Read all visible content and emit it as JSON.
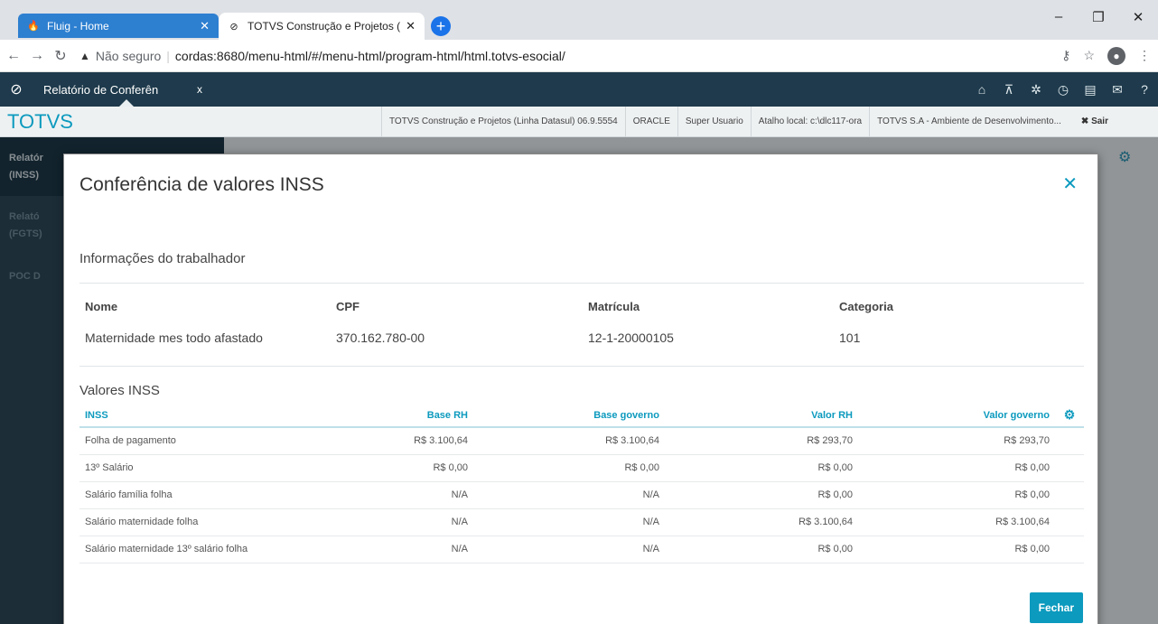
{
  "browser": {
    "tabs": [
      {
        "label": "Fluig - Home",
        "icon": "fluig-icon"
      },
      {
        "label": "TOTVS Construção e Projetos (Lin",
        "icon": "totvs-icon"
      }
    ],
    "url_security": "Não seguro",
    "url": "cordas:8680/menu-html/#/menu-html/program-html/html.totvs-esocial/"
  },
  "app": {
    "tab_label": "Relatório de Conferên",
    "brand": "TOTVS",
    "context": [
      "TOTVS Construção e Projetos (Linha Datasul) 06.9.5554",
      "ORACLE",
      "Super Usuario",
      "Atalho local: c:\\dlc117-ora",
      "TOTVS S.A - Ambiente de Desenvolvimento..."
    ],
    "sair": "✖ Sair"
  },
  "sidebar": {
    "items": [
      {
        "l1": "Relatór",
        "l2": "(INSS)"
      },
      {
        "l1": "Relató",
        "l2": "(FGTS)"
      },
      {
        "l1": "POC D",
        "l2": ""
      }
    ]
  },
  "modal": {
    "title": "Conferência de valores INSS",
    "worker_section": "Informações do trabalhador",
    "worker": {
      "headers": [
        "Nome",
        "CPF",
        "Matrícula",
        "Categoria"
      ],
      "values": [
        "Maternidade mes todo afastado",
        "370.162.780-00",
        "12-1-20000105",
        "101"
      ]
    },
    "values_section": "Valores INSS",
    "table": {
      "headers": [
        "INSS",
        "Base RH",
        "Base governo",
        "Valor RH",
        "Valor governo"
      ],
      "rows": [
        [
          "Folha de pagamento",
          "R$ 3.100,64",
          "R$ 3.100,64",
          "R$ 293,70",
          "R$ 293,70"
        ],
        [
          "13º Salário",
          "R$ 0,00",
          "R$ 0,00",
          "R$ 0,00",
          "R$ 0,00"
        ],
        [
          "Salário família folha",
          "N/A",
          "N/A",
          "R$ 0,00",
          "R$ 0,00"
        ],
        [
          "Salário maternidade folha",
          "N/A",
          "N/A",
          "R$ 3.100,64",
          "R$ 3.100,64"
        ],
        [
          "Salário maternidade 13º salário folha",
          "N/A",
          "N/A",
          "R$ 0,00",
          "R$ 0,00"
        ]
      ]
    },
    "close_button": "Fechar"
  },
  "colors": {
    "accent": "#0c9abe",
    "appbar": "#1e3a4c"
  }
}
